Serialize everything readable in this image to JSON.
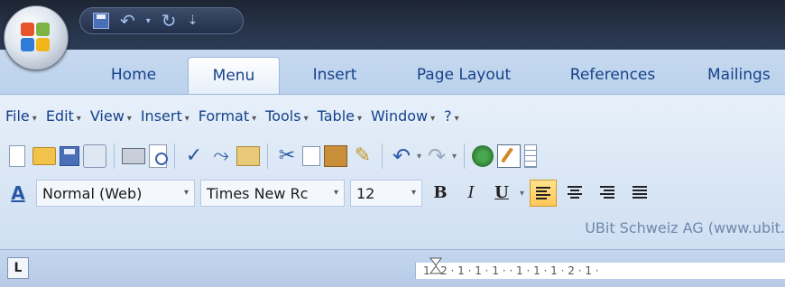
{
  "quick_access": {
    "icons": [
      "save-icon",
      "undo-icon",
      "redo-icon",
      "customize-icon"
    ],
    "dropdown_arrow": "⌄"
  },
  "ribbon_tabs": [
    {
      "label": "Home",
      "active": false
    },
    {
      "label": "Menu",
      "active": true
    },
    {
      "label": "Insert",
      "active": false
    },
    {
      "label": "Page Layout",
      "active": false
    },
    {
      "label": "References",
      "active": false
    },
    {
      "label": "Mailings",
      "active": false
    }
  ],
  "menubar": {
    "items": [
      "File",
      "Edit",
      "View",
      "Insert",
      "Format",
      "Tools",
      "Table",
      "Window",
      "?"
    ]
  },
  "formatting": {
    "style_value": "Normal (Web)",
    "font_value": "Times New Rc",
    "size_value": "12",
    "bold": "B",
    "italic": "I",
    "underline": "U"
  },
  "company_line": "UBit Schweiz AG (www.ubit.",
  "ruler": {
    "text": "1 · 2 · 1 · 1 · 1 ·   · 1 · 1 · 1 · 2 · 1 ·"
  },
  "colors": {
    "titlebar": "#1d2533",
    "tab_text": "#15428b",
    "ribbon_bg": "#dbe7f5",
    "align_active": "#ffc75a"
  }
}
